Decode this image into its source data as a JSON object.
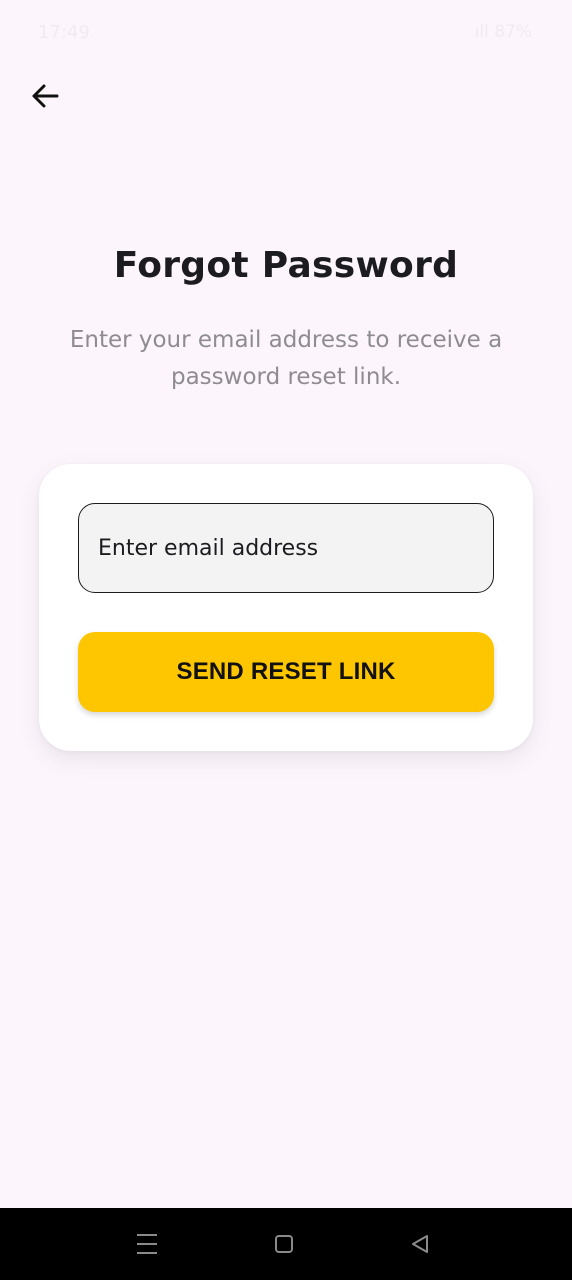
{
  "status_bar": {
    "time": "17:49",
    "right_text": "ıll 87%"
  },
  "header": {
    "back_icon": "arrow-left-icon"
  },
  "main": {
    "title": "Forgot Password",
    "subtitle": "Enter your email address to receive a password reset link."
  },
  "form": {
    "email_placeholder": "Enter email address",
    "email_value": "",
    "submit_label": "SEND RESET LINK"
  },
  "nav_bar": {
    "icons": [
      "menu-icon",
      "home-icon",
      "back-triangle-icon"
    ]
  },
  "colors": {
    "background": "#fcf6fc",
    "accent": "#fec601",
    "text": "#1c1b1f",
    "muted": "#8f8c90"
  }
}
